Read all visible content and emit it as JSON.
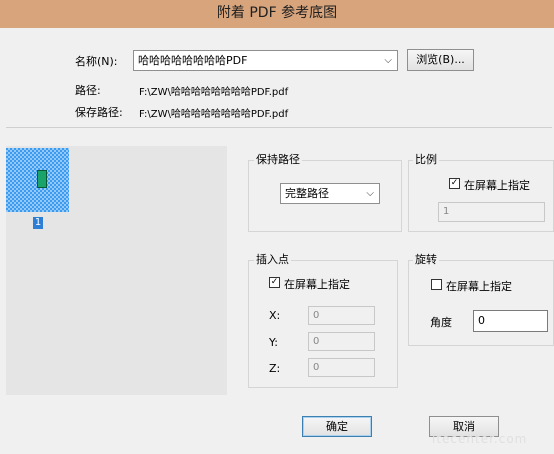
{
  "window": {
    "title": "附着 PDF 参考底图"
  },
  "file": {
    "name_label": "名称(N):",
    "name_value": "哈哈哈哈哈哈哈哈PDF",
    "browse_label": "浏览(B)...",
    "path_label": "路径:",
    "path_value": "F:\\ZW\\哈哈哈哈哈哈哈哈PDF.pdf",
    "saved_path_label": "保存路径:",
    "saved_path_value": "F:\\ZW\\哈哈哈哈哈哈哈哈PDF.pdf"
  },
  "preview": {
    "page_number": "1"
  },
  "path_type": {
    "title": "保持路径",
    "selected": "完整路径"
  },
  "scale": {
    "title": "比例",
    "specify_label": "在屏幕上指定",
    "specify_checked": true,
    "value": "1"
  },
  "insertion": {
    "title": "插入点",
    "specify_label": "在屏幕上指定",
    "specify_checked": true,
    "x_label": "X:",
    "x_value": "0",
    "y_label": "Y:",
    "y_value": "0",
    "z_label": "Z:",
    "z_value": "0"
  },
  "rotation": {
    "title": "旋转",
    "specify_label": "在屏幕上指定",
    "specify_checked": false,
    "angle_label": "角度",
    "angle_value": "0"
  },
  "buttons": {
    "ok": "确定",
    "cancel": "取消"
  },
  "watermark": "itecenter.com"
}
